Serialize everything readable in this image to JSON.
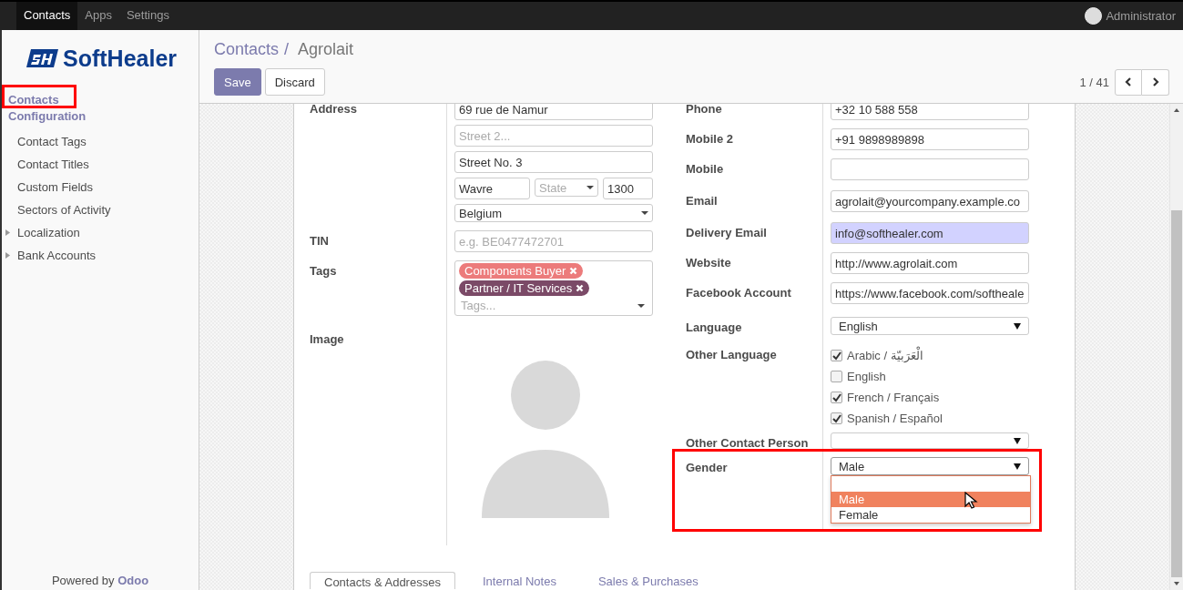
{
  "navbar": {
    "apps": [
      {
        "label": "Contacts",
        "selected": true
      },
      {
        "label": "Apps",
        "selected": false
      },
      {
        "label": "Settings",
        "selected": false
      }
    ],
    "user": {
      "name": "Administrator"
    }
  },
  "sidebar": {
    "logo": {
      "text": "SoftHealer"
    },
    "sections": [
      {
        "label": "Contacts",
        "marked": true
      },
      {
        "label": "Configuration",
        "marked": false,
        "items": [
          {
            "label": "Contact Tags",
            "kind": "leaf"
          },
          {
            "label": "Contact Titles",
            "kind": "leaf"
          },
          {
            "label": "Custom Fields",
            "kind": "leaf"
          },
          {
            "label": "Sectors of Activity",
            "kind": "leaf"
          },
          {
            "label": "Localization",
            "kind": "folder",
            "expanded": false
          },
          {
            "label": "Bank Accounts",
            "kind": "folder",
            "expanded": false
          }
        ]
      }
    ],
    "footer": "Powered by **Odoo**"
  },
  "control_panel": {
    "breadcrumbs": [
      {
        "label": "Contacts",
        "link": true
      },
      {
        "label": "Agrolait",
        "link": false
      }
    ],
    "separator": "/",
    "buttons": [
      {
        "label": "Save",
        "kind": "primary"
      },
      {
        "label": "Discard",
        "kind": "secondary"
      }
    ],
    "pager": {
      "text": "1 / 41"
    }
  },
  "form": {
    "left": [
      {
        "label": "Address",
        "kind": "fields",
        "marked": false,
        "lines": [
          [
            {
              "kind": "input",
              "value": "69 rue de Namur",
              "highlighted": false
            }
          ],
          [
            {
              "kind": "input",
              "placeholder": "Street 2...",
              "highlighted": false
            }
          ],
          [
            {
              "kind": "input",
              "value": "Street No. 3",
              "highlighted": false
            }
          ],
          [
            {
              "kind": "input",
              "value": "Wavre",
              "highlighted": false
            },
            {
              "kind": "many2one",
              "placeholder": "State"
            },
            {
              "kind": "input",
              "value": "1300",
              "highlighted": false
            }
          ],
          [
            {
              "kind": "many2one",
              "value": "Belgium"
            }
          ]
        ]
      },
      {
        "label": "TIN",
        "kind": "fields",
        "marked": false,
        "lines": [
          [
            {
              "kind": "input",
              "placeholder": "e.g. BE0477472701",
              "highlighted": false
            }
          ]
        ]
      },
      {
        "label": "Tags",
        "kind": "tags",
        "marked": false,
        "tags": [
          {
            "label": "Components Buyer",
            "color": "#ec7b7b"
          },
          {
            "label": "Partner / IT Services",
            "color": "#7b4a67"
          }
        ],
        "placeholder": "Tags..."
      },
      {
        "label": "Image",
        "kind": "image",
        "marked": false
      }
    ],
    "right": [
      {
        "label": "Phone",
        "kind": "fields",
        "marked": false,
        "lines": [
          [
            {
              "kind": "input",
              "value": "+32 10 588 558",
              "highlighted": false
            }
          ]
        ]
      },
      {
        "label": "Mobile 2",
        "kind": "fields",
        "marked": false,
        "lines": [
          [
            {
              "kind": "input",
              "value": "+91 9898989898",
              "highlighted": false
            }
          ]
        ]
      },
      {
        "label": "Mobile",
        "kind": "fields",
        "marked": false,
        "lines": [
          [
            {
              "kind": "input",
              "highlighted": false
            }
          ]
        ]
      },
      {
        "label": "Email",
        "kind": "fields",
        "marked": false,
        "lines": [
          [
            {
              "kind": "input",
              "value": "agrolait@yourcompany.example.co",
              "highlighted": false
            }
          ]
        ]
      },
      {
        "label": "Delivery Email",
        "kind": "fields",
        "marked": false,
        "lines": [
          [
            {
              "kind": "input",
              "value": "info@softhealer.com",
              "highlighted": true
            }
          ]
        ]
      },
      {
        "label": "Website",
        "kind": "fields",
        "marked": false,
        "lines": [
          [
            {
              "kind": "input",
              "value": "http://www.agrolait.com",
              "highlighted": false
            }
          ]
        ]
      },
      {
        "label": "Facebook Account",
        "kind": "fields",
        "marked": false,
        "lines": [
          [
            {
              "kind": "input",
              "value": "https://www.facebook.com/softheale",
              "highlighted": false
            }
          ]
        ]
      },
      {
        "label": "Language",
        "kind": "fields",
        "marked": false,
        "lines": [
          [
            {
              "kind": "select",
              "value": "English",
              "open": false
            }
          ]
        ]
      },
      {
        "label": "Other Language",
        "kind": "checkboxes",
        "marked": false,
        "options": [
          {
            "label": "Arabic / الْعَرَبيّة",
            "checked": true
          },
          {
            "label": "English",
            "checked": false
          },
          {
            "label": "French / Français",
            "checked": true
          },
          {
            "label": "Spanish / Español",
            "checked": true
          }
        ]
      },
      {
        "label": "Other Contact Person",
        "kind": "fields",
        "marked": false,
        "lines": [
          [
            {
              "kind": "select",
              "open": false
            }
          ]
        ]
      },
      {
        "label": "Gender",
        "kind": "fields",
        "marked": true,
        "lines": [
          [
            {
              "kind": "select",
              "value": "Male",
              "open": true,
              "options": [
                {
                  "label": "Male",
                  "selected": true
                },
                {
                  "label": "Female",
                  "selected": false
                }
              ]
            }
          ]
        ]
      }
    ]
  },
  "notebook": {
    "tabs": [
      {
        "label": "Contacts & Addresses",
        "selected": true
      },
      {
        "label": "Internal Notes",
        "selected": false
      },
      {
        "label": "Sales & Purchases",
        "selected": false
      }
    ]
  }
}
